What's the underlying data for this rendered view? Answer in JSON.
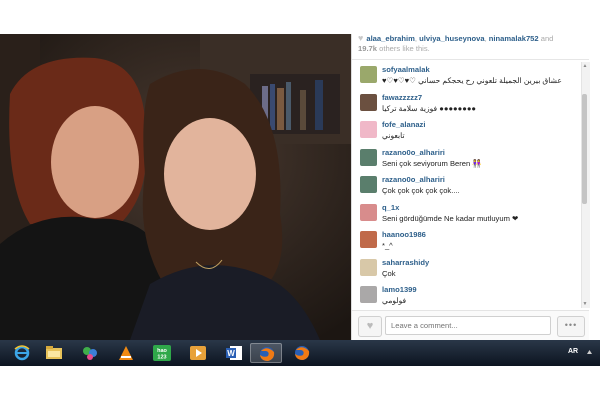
{
  "likes": {
    "users": [
      "alaa_ebrahim",
      "ulviya_huseynova",
      "ninamalak752"
    ],
    "sep1": ", ",
    "sep2": ", ",
    "and_text": " and",
    "count": "19.7k",
    "others_text": " others like this."
  },
  "comments": [
    {
      "user": "sofyaalmalak",
      "text": "♥♡♥♡♥♡ عشاق بيرين الجميلة تلعوني رح يحجكم حساني",
      "avatar": "#9aa86b"
    },
    {
      "user": "fawazzzzz7",
      "text": "فوزية سلامة تركيا ●●●●●●●●",
      "avatar": "#6b5040"
    },
    {
      "user": "fofe_alanazi",
      "text": "تابعوني",
      "avatar": "#f0b8c8"
    },
    {
      "user": "razano0o_alhariri",
      "text": "Seni çok seviyorum Beren 👭",
      "avatar": "#5a7e6c"
    },
    {
      "user": "razano0o_alhariri",
      "text": "Çok çok çok çok çok....",
      "avatar": "#5a7e6c"
    },
    {
      "user": "q_1x",
      "text": "Seni gördüğümde Ne kadar mutluyum ❤",
      "avatar": "#d88c8c"
    },
    {
      "user": "haanoo1986",
      "text": "*_^",
      "avatar": "#c06a4a"
    },
    {
      "user": "saharrashidy",
      "text": "Çok",
      "avatar": "#d8c8a8"
    },
    {
      "user": "lamo1399",
      "text": "فولومي",
      "avatar": "#aaa8a8"
    }
  ],
  "comment_placeholder": "Leave a comment...",
  "more_label": "•••",
  "like_icon": "heart-icon",
  "taskbar": {
    "apps": [
      {
        "name": "ie-icon"
      },
      {
        "name": "explorer-icon"
      },
      {
        "name": "messenger-icon"
      },
      {
        "name": "vlc-icon"
      },
      {
        "name": "hao123-icon",
        "label": "hao\n123"
      },
      {
        "name": "media-player-icon"
      },
      {
        "name": "word-icon",
        "label": "W"
      },
      {
        "name": "firefox-icon",
        "active": true
      },
      {
        "name": "firefox-icon-2"
      }
    ],
    "lang": "AR"
  }
}
